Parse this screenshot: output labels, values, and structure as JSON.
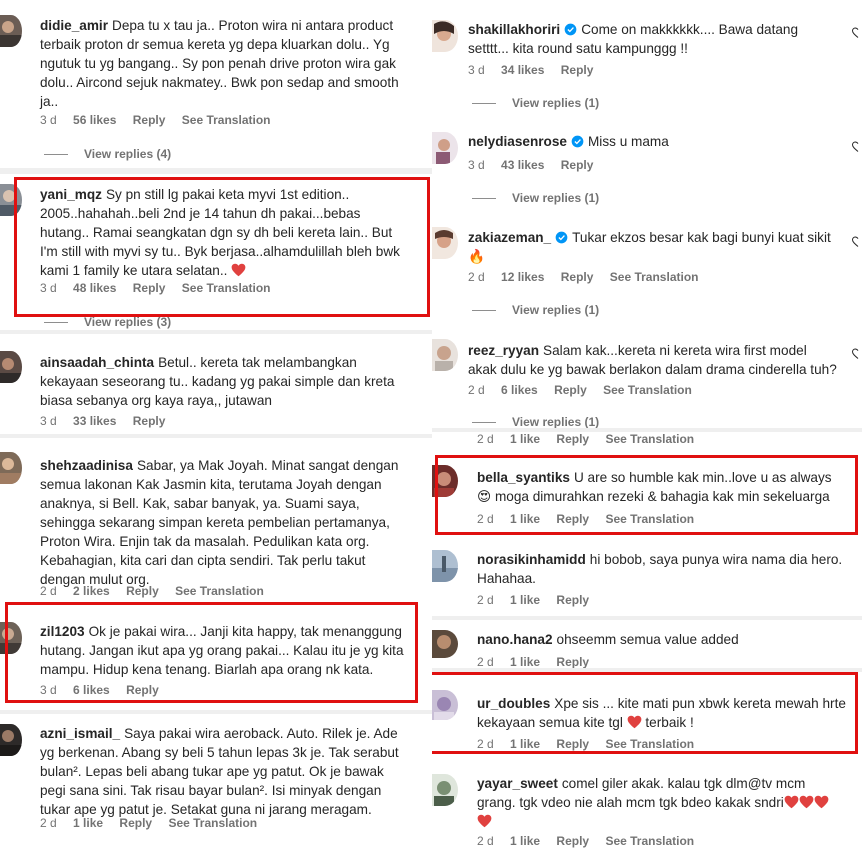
{
  "common": {
    "like_action": "Reply",
    "see_translation": "See Translation"
  },
  "left": {
    "comments": [
      {
        "username": "didie_amir",
        "text": "Depa tu x tau ja.. Proton wira ni antara product\nterbaik proton dr semua kereta yg depa kluarkan dolu.. Yg\nngutuk tu yg bangang.. Sy pon penah drive proton wira gak\ndolu.. Aircond sejuk nakmatey.. Bwk pon sedap and smooth\nja..",
        "time": "3 d",
        "likes": "56 likes",
        "reply": "Reply",
        "translate": "See Translation",
        "view_replies": "View replies (4)"
      },
      {
        "username": "yani_mqz",
        "text": "Sy pn still lg pakai keta myvi 1st edition..\n2005..hahahah..beli 2nd je 14 tahun dh pakai...bebas\nhutang.. Ramai seangkatan dgn sy dh beli kereta lain.. But\nI'm still with myvi sy tu.. Byk berjasa..alhamdulillah bleh bwk\nkami 1 family ke utara selatan..",
        "time": "3 d",
        "likes": "48 likes",
        "reply": "Reply",
        "translate": "See Translation",
        "view_replies": "View replies (3)"
      },
      {
        "username": "ainsaadah_chinta",
        "text": "Betul.. kereta tak melambangkan\nkekayaan seseorang tu.. kadang yg pakai simple dan kreta\nbiasa sebanya org kaya raya,, jutawan",
        "time": "3 d",
        "likes": "33 likes",
        "reply": "Reply"
      },
      {
        "username": "shehzaadinisa",
        "text": "Sabar, ya Mak Joyah. Minat sangat dengan\nsemua lakonan Kak Jasmin kita, terutama Joyah dengan\nanaknya, si Bell. Kak, sabar banyak, ya. Suami saya,\nsehingga sekarang simpan kereta pembelian pertamanya,\nProton Wira. Enjin tak da masalah. Pedulikan kata org.\nKebahagian, kita cari dan cipta sendiri. Tak perlu takut\ndengan mulut org.",
        "time": "2 d",
        "likes": "2 likes",
        "reply": "Reply",
        "translate": "See Translation"
      },
      {
        "username": "zil1203",
        "text": "Ok je pakai wira... Janji kita happy, tak menanggung\nhutang. Jangan ikut apa yg orang pakai... Kalau itu je yg kita\nmampu. Hidup kena tenang. Biarlah apa orang nk kata.",
        "time": "3 d",
        "likes": "6 likes",
        "reply": "Reply"
      },
      {
        "username": "azni_ismail_",
        "text": "Saya pakai wira aeroback. Auto. Rilek je. Ade\nyg berkenan. Abang sy beli 5 tahun lepas 3k je. Tak serabut\nbulan². Lepas beli abang tukar ape yg patut. Ok je bawak\npegi sana sini. Tak risau bayar bulan². Isi minyak dengan\ntukar ape yg patut je. Setakat guna ni jarang meragam.",
        "time": "2 d",
        "likes": "1 like",
        "reply": "Reply",
        "translate": "See Translation"
      }
    ]
  },
  "right": {
    "comments": [
      {
        "username": "shakillakhoriri",
        "verified": true,
        "text": "Come on makkkkkk.... Bawa datang\nsetttt... kita round satu kampunggg !!",
        "time": "3 d",
        "likes": "34 likes",
        "reply": "Reply",
        "view_replies": "View replies (1)"
      },
      {
        "username": "nelydiasenrose",
        "verified": true,
        "text": "Miss u mama",
        "time": "3 d",
        "likes": "43 likes",
        "reply": "Reply",
        "view_replies": "View replies (1)"
      },
      {
        "username": "zakiazeman_",
        "verified": true,
        "text": "Tukar ekzos besar kak bagi bunyi kuat sikit\n🔥",
        "time": "2 d",
        "likes": "12 likes",
        "reply": "Reply",
        "translate": "See Translation",
        "view_replies": "View replies (1)"
      },
      {
        "username": "reez_ryyan",
        "text": "Salam kak...kereta ni kereta wira first model\nakak dulu ke yg bawak berlakon dalam drama cinderella tuh?",
        "time": "2 d",
        "likes": "6 likes",
        "reply": "Reply",
        "translate": "See Translation",
        "view_replies": "View replies (1)"
      },
      {
        "username": "bella_syantiks",
        "text": "U are so humble kak min..love u as always\n😍 moga dimurahkan rezeki & bahagia kak min sekeluarga",
        "time": "2 d",
        "likes": "1 like",
        "reply": "Reply",
        "translate": "See Translation"
      },
      {
        "username": "norasikinhamidd",
        "text": "hi bobob, saya punya wira nama dia hero.\nHahahaa.",
        "time": "2 d",
        "likes": "1 like",
        "reply": "Reply"
      },
      {
        "username": "nano.hana2",
        "text": "ohseemm semua value added",
        "time": "2 d",
        "likes": "1 like",
        "reply": "Reply"
      },
      {
        "username": "ur_doubles",
        "text": "Xpe sis ... kite mati pun xbwk kereta mewah hrte\nkekayaan semua kite tgl",
        "text_suffix": "terbaik !",
        "time": "2 d",
        "likes": "1 like",
        "reply": "Reply",
        "translate": "See Translation"
      },
      {
        "username": "yayar_sweet",
        "text": "comel giler akak. kalau tgk dlm@tv mcm\ngrang. tgk vdeo nie alah mcm tgk bdeo kakak sndri",
        "time": "2 d",
        "likes": "1 like",
        "reply": "Reply",
        "translate": "See Translation"
      }
    ],
    "strip_meta": {
      "time": "2 d",
      "likes": "1 like",
      "reply": "Reply",
      "translate": "See Translation"
    }
  },
  "colors": {
    "highlight_box": "#e01010",
    "text": "#262626",
    "meta": "#737373",
    "verified": "#0095f6",
    "heart": "#ed4956"
  }
}
